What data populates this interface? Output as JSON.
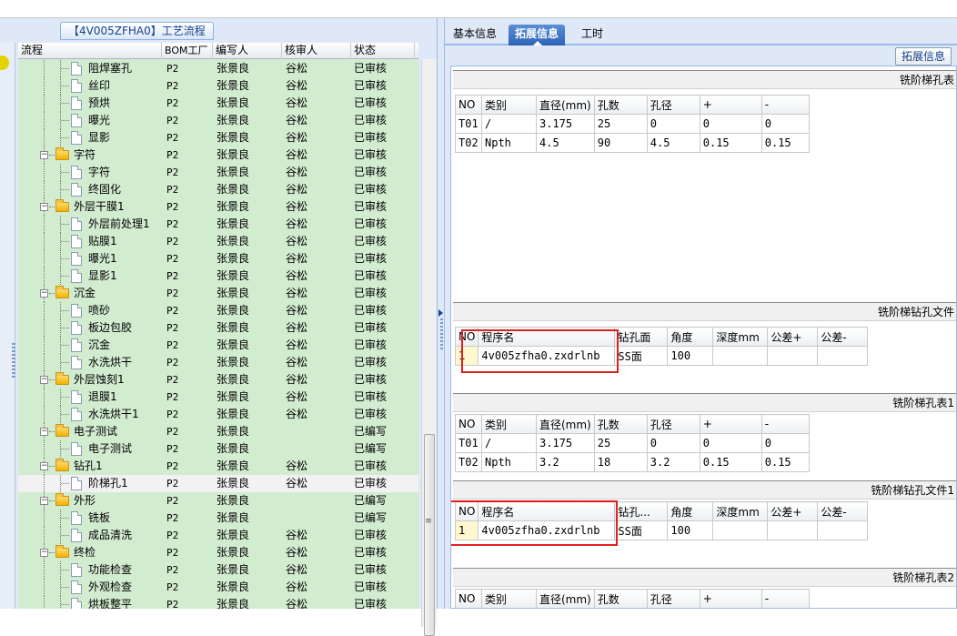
{
  "left": {
    "panel_title": "【4V005ZFHA0】工艺流程",
    "columns": {
      "flow": "流程",
      "bom": "BOM工厂",
      "writer": "编写人",
      "checker": "核审人",
      "status": "状态"
    },
    "rows": [
      {
        "name": "阻焊塞孔",
        "type": "leaf",
        "bom": "P2",
        "writer": "张景良",
        "checker": "谷松",
        "status": "已审核"
      },
      {
        "name": "丝印",
        "type": "leaf",
        "bom": "P2",
        "writer": "张景良",
        "checker": "谷松",
        "status": "已审核"
      },
      {
        "name": "预烘",
        "type": "leaf",
        "bom": "P2",
        "writer": "张景良",
        "checker": "谷松",
        "status": "已审核"
      },
      {
        "name": "曝光",
        "type": "leaf",
        "bom": "P2",
        "writer": "张景良",
        "checker": "谷松",
        "status": "已审核"
      },
      {
        "name": "显影",
        "type": "leaf",
        "bom": "P2",
        "writer": "张景良",
        "checker": "谷松",
        "status": "已审核"
      },
      {
        "name": "字符",
        "type": "folder",
        "bom": "P2",
        "writer": "张景良",
        "checker": "谷松",
        "status": "已审核"
      },
      {
        "name": "字符",
        "type": "leaf",
        "bom": "P2",
        "writer": "张景良",
        "checker": "谷松",
        "status": "已审核"
      },
      {
        "name": "终固化",
        "type": "leaf",
        "bom": "P2",
        "writer": "张景良",
        "checker": "谷松",
        "status": "已审核"
      },
      {
        "name": "外层干膜1",
        "type": "folder",
        "bom": "P2",
        "writer": "张景良",
        "checker": "谷松",
        "status": "已审核"
      },
      {
        "name": "外层前处理1",
        "type": "leaf",
        "bom": "P2",
        "writer": "张景良",
        "checker": "谷松",
        "status": "已审核"
      },
      {
        "name": "贴膜1",
        "type": "leaf",
        "bom": "P2",
        "writer": "张景良",
        "checker": "谷松",
        "status": "已审核"
      },
      {
        "name": "曝光1",
        "type": "leaf",
        "bom": "P2",
        "writer": "张景良",
        "checker": "谷松",
        "status": "已审核"
      },
      {
        "name": "显影1",
        "type": "leaf",
        "bom": "P2",
        "writer": "张景良",
        "checker": "谷松",
        "status": "已审核"
      },
      {
        "name": "沉金",
        "type": "folder",
        "bom": "P2",
        "writer": "张景良",
        "checker": "谷松",
        "status": "已审核"
      },
      {
        "name": "喷砂",
        "type": "leaf",
        "bom": "P2",
        "writer": "张景良",
        "checker": "谷松",
        "status": "已审核"
      },
      {
        "name": "板边包胶",
        "type": "leaf",
        "bom": "P2",
        "writer": "张景良",
        "checker": "谷松",
        "status": "已审核"
      },
      {
        "name": "沉金",
        "type": "leaf",
        "bom": "P2",
        "writer": "张景良",
        "checker": "谷松",
        "status": "已审核"
      },
      {
        "name": "水洗烘干",
        "type": "leaf",
        "bom": "P2",
        "writer": "张景良",
        "checker": "谷松",
        "status": "已审核"
      },
      {
        "name": "外层蚀刻1",
        "type": "folder",
        "bom": "P2",
        "writer": "张景良",
        "checker": "谷松",
        "status": "已审核"
      },
      {
        "name": "退膜1",
        "type": "leaf",
        "bom": "P2",
        "writer": "张景良",
        "checker": "谷松",
        "status": "已审核"
      },
      {
        "name": "水洗烘干1",
        "type": "leaf",
        "bom": "P2",
        "writer": "张景良",
        "checker": "谷松",
        "status": "已审核"
      },
      {
        "name": "电子测试",
        "type": "folder",
        "bom": "P2",
        "writer": "张景良",
        "checker": "",
        "status": "已编写"
      },
      {
        "name": "电子测试",
        "type": "leaf",
        "bom": "P2",
        "writer": "张景良",
        "checker": "",
        "status": "已编写"
      },
      {
        "name": "钻孔1",
        "type": "folder",
        "bom": "P2",
        "writer": "张景良",
        "checker": "谷松",
        "status": "已审核"
      },
      {
        "name": "阶梯孔1",
        "type": "leaf",
        "bom": "P2",
        "writer": "张景良",
        "checker": "谷松",
        "status": "已审核",
        "selected": true
      },
      {
        "name": "外形",
        "type": "folder",
        "bom": "P2",
        "writer": "张景良",
        "checker": "",
        "status": "已编写"
      },
      {
        "name": "铣板",
        "type": "leaf",
        "bom": "P2",
        "writer": "张景良",
        "checker": "",
        "status": "已编写"
      },
      {
        "name": "成品清洗",
        "type": "leaf",
        "bom": "P2",
        "writer": "张景良",
        "checker": "谷松",
        "status": "已审核"
      },
      {
        "name": "终检",
        "type": "folder",
        "bom": "P2",
        "writer": "张景良",
        "checker": "谷松",
        "status": "已审核"
      },
      {
        "name": "功能检查",
        "type": "leaf",
        "bom": "P2",
        "writer": "张景良",
        "checker": "谷松",
        "status": "已审核"
      },
      {
        "name": "外观检查",
        "type": "leaf",
        "bom": "P2",
        "writer": "张景良",
        "checker": "谷松",
        "status": "已审核"
      },
      {
        "name": "烘板整平",
        "type": "leaf",
        "bom": "P2",
        "writer": "张景良",
        "checker": "谷松",
        "status": "已审核"
      }
    ]
  },
  "right": {
    "tabs": [
      "基本信息",
      "拓展信息",
      "工时"
    ],
    "active_tab": "拓展信息",
    "ext_button": "拓展信息",
    "sec1": {
      "title": "铣阶梯孔表",
      "headers": [
        "NO",
        "类别",
        "直径(mm)",
        "孔数",
        "孔径",
        "+",
        "-"
      ],
      "rows": [
        [
          "T01",
          "/",
          "3.175",
          "25",
          "0",
          "0",
          "0"
        ],
        [
          "T02",
          "Npth",
          "4.5",
          "90",
          "4.5",
          "0.15",
          "0.15"
        ]
      ]
    },
    "sec2": {
      "title": "铣阶梯钻孔文件",
      "headers": [
        "NO",
        "程序名",
        "钻孔面",
        "角度",
        "深度mm",
        "公差+",
        "公差-"
      ],
      "rows": [
        [
          "1",
          "4v005zfha0.zxdrlnb",
          "SS面",
          "100",
          "",
          "",
          ""
        ]
      ]
    },
    "sec3": {
      "title": "铣阶梯孔表1",
      "headers": [
        "NO",
        "类别",
        "直径(mm)",
        "孔数",
        "孔径",
        "+",
        "-"
      ],
      "rows": [
        [
          "T01",
          "/",
          "3.175",
          "25",
          "0",
          "0",
          "0"
        ],
        [
          "T02",
          "Npth",
          "3.2",
          "18",
          "3.2",
          "0.15",
          "0.15"
        ]
      ]
    },
    "sec4": {
      "title": "铣阶梯钻孔文件1",
      "headers": [
        "NO",
        "程序名",
        "钻孔...",
        "角度",
        "深度mm",
        "公差+",
        "公差-"
      ],
      "rows": [
        [
          "1",
          "4v005zfha0.zxdrlnb",
          "SS面",
          "100",
          "",
          "",
          ""
        ]
      ]
    },
    "sec5": {
      "title": "铣阶梯孔表2",
      "headers": [
        "NO",
        "类别",
        "直径(mm)",
        "孔数",
        "孔径",
        "+",
        "-"
      ]
    }
  }
}
